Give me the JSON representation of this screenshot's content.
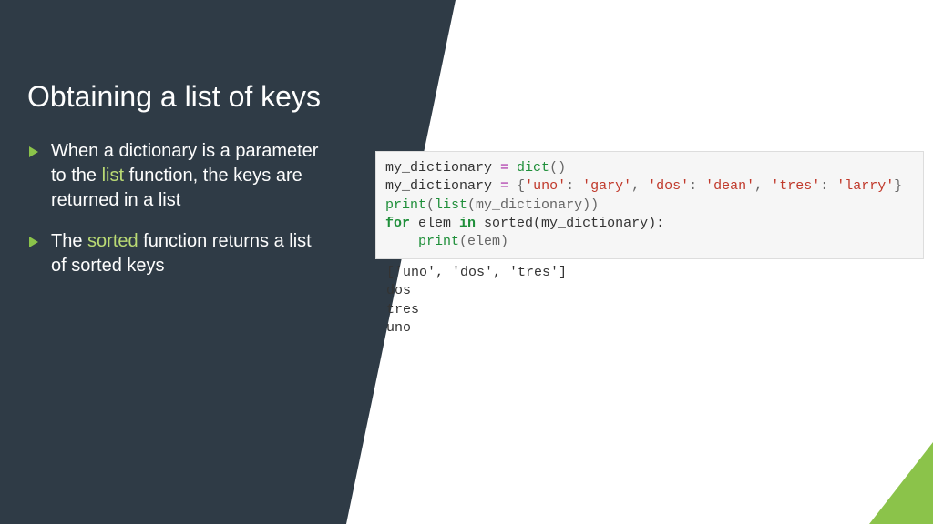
{
  "colors": {
    "panel_bg": "#2f3b46",
    "accent": "#8bc34a",
    "highlight_text": "#bada74",
    "code_bg": "#f6f6f6"
  },
  "title": "Obtaining a list of keys",
  "bullets": [
    {
      "pre": "When a dictionary is a parameter to the ",
      "hl": "list",
      "post": " function, the keys are returned in a list"
    },
    {
      "pre": "The ",
      "hl": "sorted",
      "post": " function returns a list of sorted keys"
    }
  ],
  "code": {
    "l1_var": "my_dictionary ",
    "l1_eq": "=",
    "l1_fn": " dict",
    "l1_paren": "()",
    "l2_var": "my_dictionary ",
    "l2_eq": "=",
    "l2_ob": " {",
    "l2_k1": "'uno'",
    "l2_c1": ": ",
    "l2_v1": "'gary'",
    "l2_s1": ", ",
    "l2_k2": "'dos'",
    "l2_c2": ": ",
    "l2_v2": "'dean'",
    "l2_s2": ", ",
    "l2_k3": "'tres'",
    "l2_c3": ": ",
    "l2_v3": "'larry'",
    "l2_cb": "}",
    "l3_fn1": "print",
    "l3_op": "(",
    "l3_fn2": "list",
    "l3_rest": "(my_dictionary))",
    "l4_for": "for",
    "l4_mid1": " elem ",
    "l4_in": "in",
    "l4_mid2": " sorted(my_dictionary):",
    "l5_indent": "    ",
    "l5_fn": "print",
    "l5_rest": "(elem)"
  },
  "output": "['uno', 'dos', 'tres']\ndos\ntres\nuno"
}
